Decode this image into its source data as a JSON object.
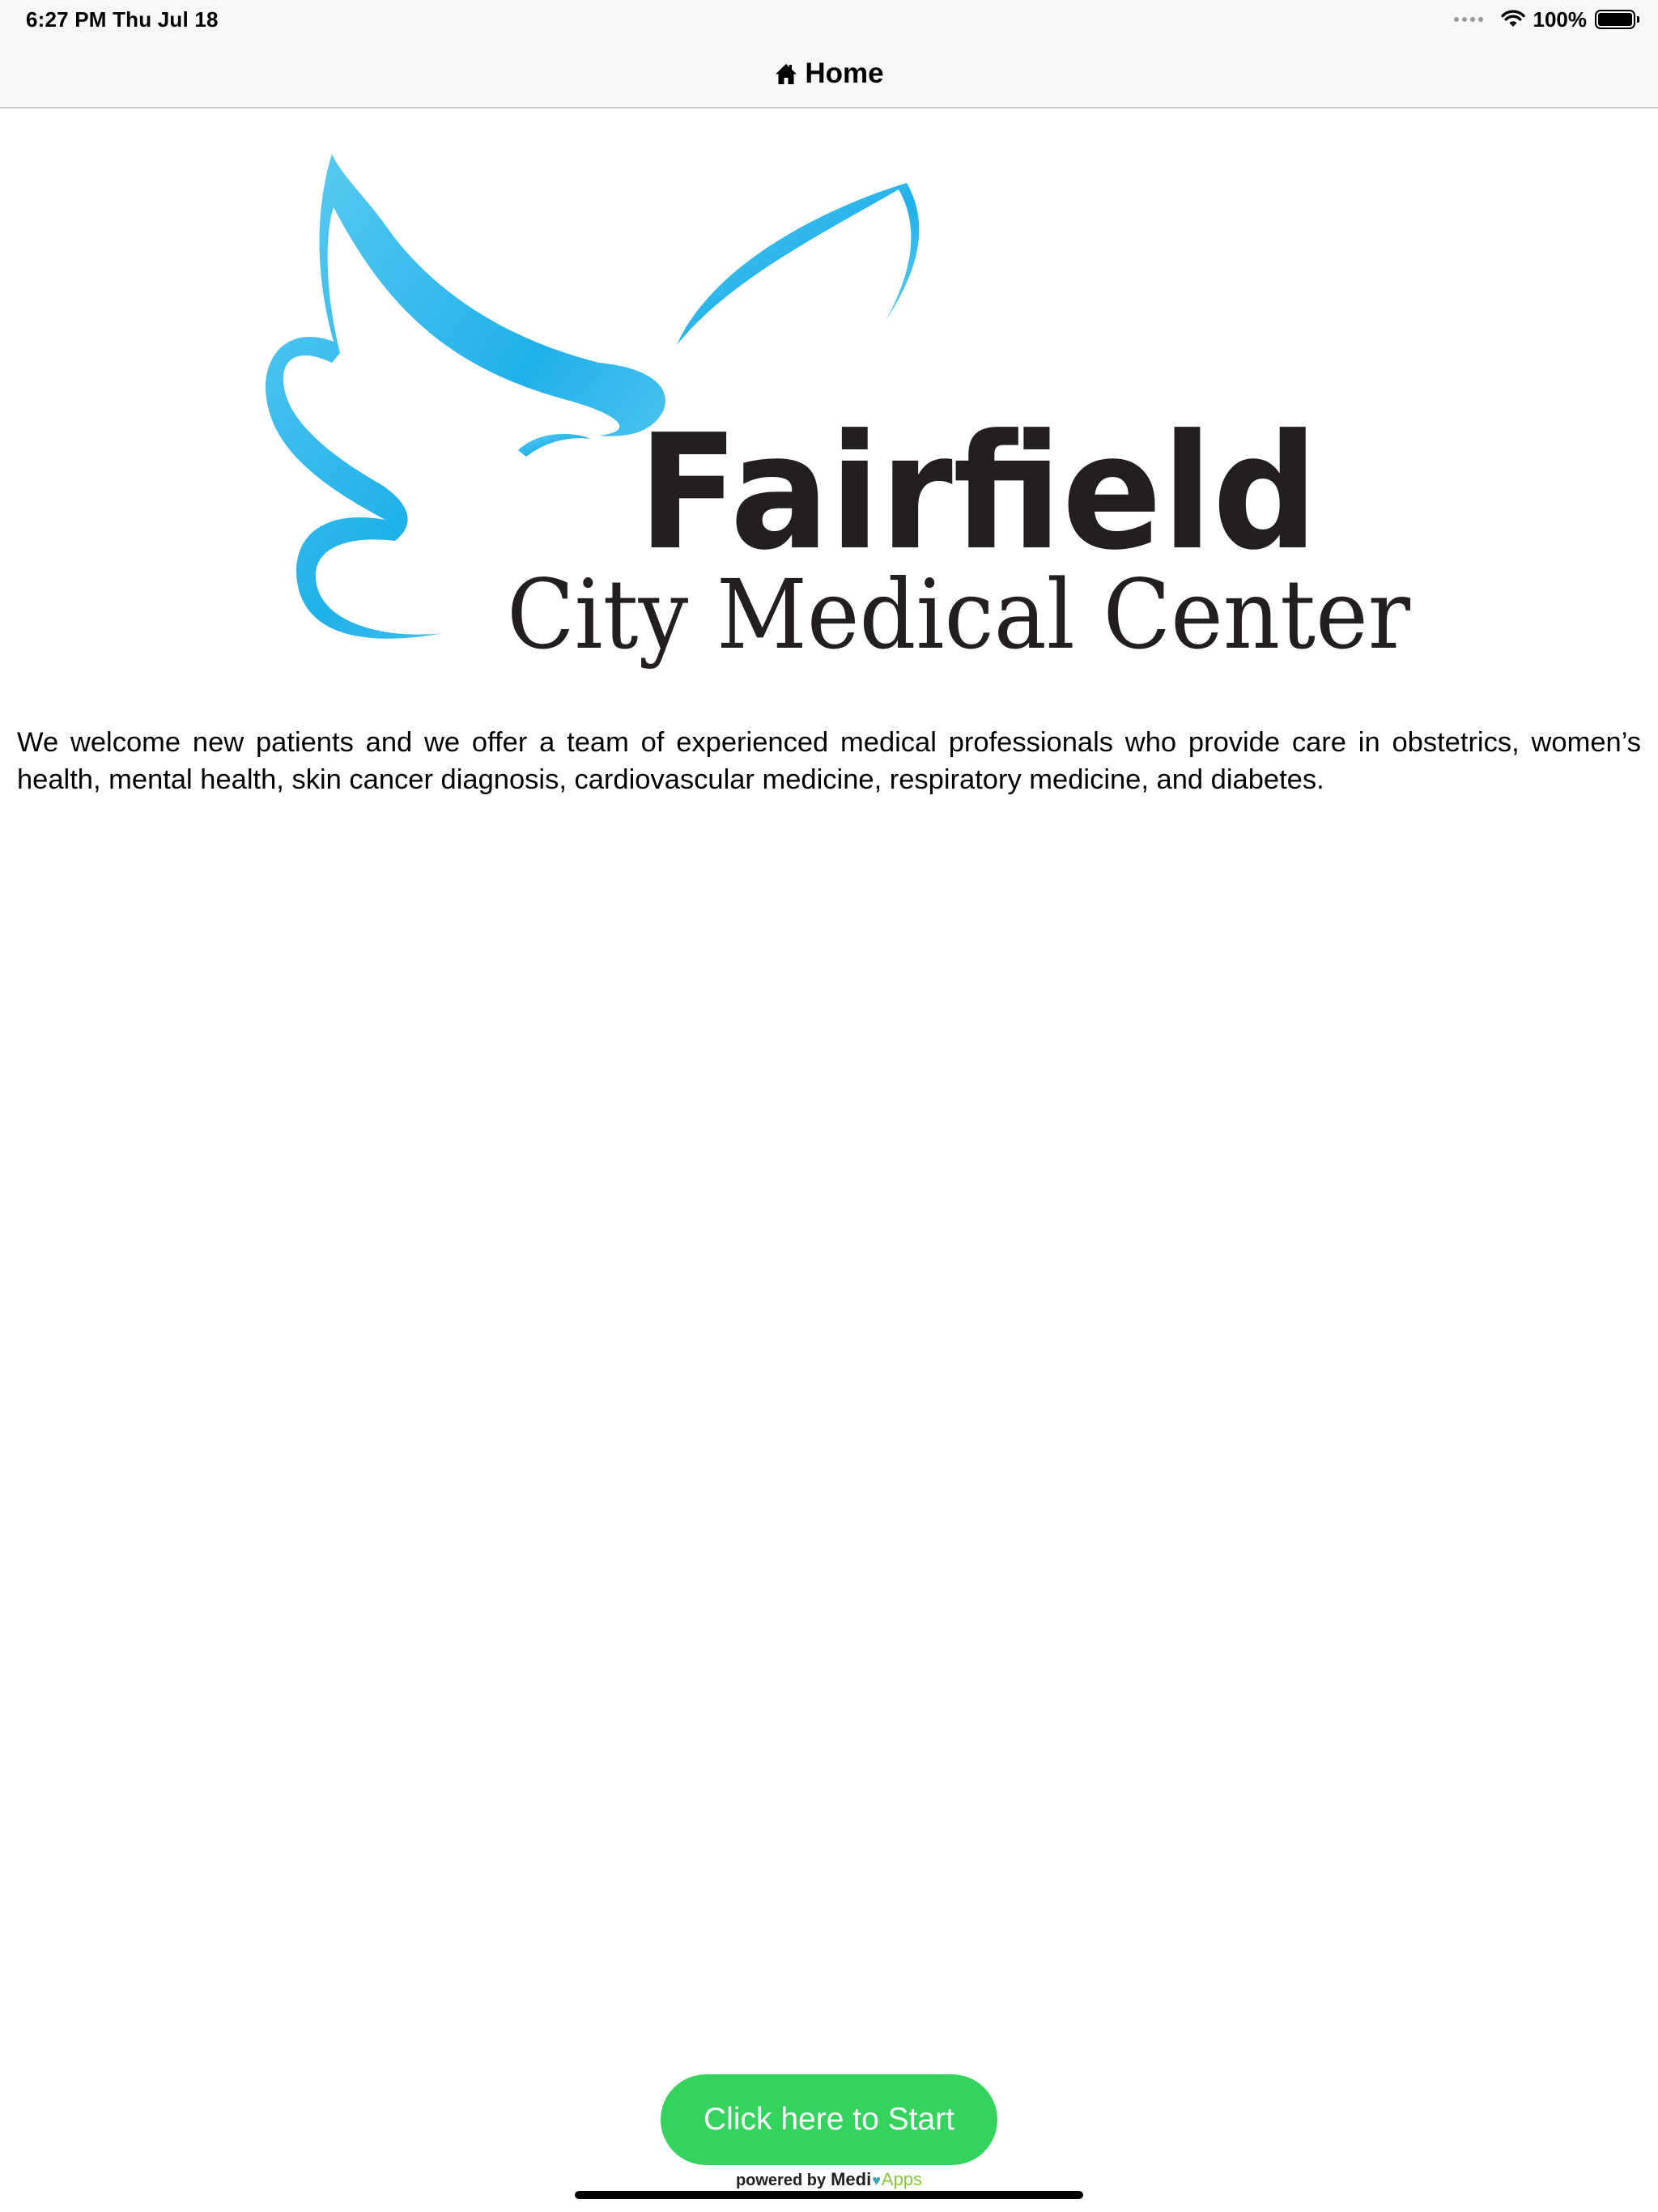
{
  "status_bar": {
    "time": "6:27 PM   Thu Jul 18",
    "battery_percent": "100%",
    "battery_level": 1.0
  },
  "nav_bar": {
    "icon": "home-icon",
    "title": "Home"
  },
  "logo": {
    "name": "Fairfield",
    "subtitle": "City Medical Center",
    "colors": {
      "wing": "#3cbdea",
      "wordmark": "#231f20"
    }
  },
  "intro": {
    "text": "We welcome new patients and we offer a team of experienced medical professionals who provide care in obstetrics, women’s health, mental health, skin cancer diagnosis, cardiovascular medicine, respiratory medicine, and diabetes."
  },
  "cta": {
    "label": "Click here to Start",
    "color": "#34d35e"
  },
  "footer": {
    "powered_by": "powered by",
    "brand_medi": "Medi",
    "brand_apps": "Apps"
  }
}
